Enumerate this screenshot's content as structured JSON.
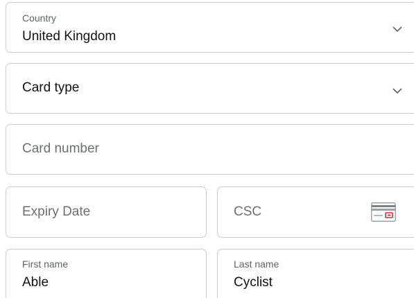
{
  "country": {
    "label": "Country",
    "value": "United Kingdom"
  },
  "card_type": {
    "label": "Card type"
  },
  "card_number": {
    "placeholder": "Card number"
  },
  "expiry_date": {
    "placeholder": "Expiry Date"
  },
  "csc": {
    "placeholder": "CSC",
    "icon": "card-csc-icon"
  },
  "first_name": {
    "label": "First name",
    "value": "Able"
  },
  "last_name": {
    "label": "Last name",
    "value": "Cyclist"
  },
  "colors": {
    "border": "#c9cbd0",
    "label": "#5f6368",
    "text": "#111111",
    "placeholder": "#6b6e73",
    "csc_accent": "#e0243a"
  }
}
